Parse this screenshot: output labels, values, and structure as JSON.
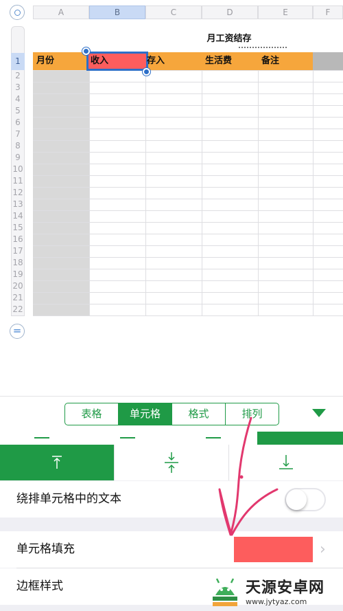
{
  "sheet": {
    "columns": [
      "A",
      "B",
      "C",
      "D",
      "E",
      "F"
    ],
    "selected_column": "B",
    "row_numbers": [
      "1",
      "2",
      "3",
      "4",
      "5",
      "6",
      "7",
      "8",
      "9",
      "10",
      "11",
      "12",
      "13",
      "14",
      "15",
      "16",
      "17",
      "18",
      "19",
      "20",
      "21",
      "22"
    ],
    "title": "月工资结存",
    "headers": [
      "月份",
      "收入",
      "存入",
      "生活费",
      "备注"
    ]
  },
  "tabs": [
    {
      "label": "表格",
      "active": false
    },
    {
      "label": "单元格",
      "active": true
    },
    {
      "label": "格式",
      "active": false
    },
    {
      "label": "排列",
      "active": false
    }
  ],
  "settings": {
    "wrap_text_label": "绕排单元格中的文本",
    "wrap_text_on": false,
    "cell_fill_label": "单元格填充",
    "cell_fill_color": "#fd5d5d",
    "border_style_label": "边框样式"
  },
  "colors": {
    "accent": "#1f9a46",
    "header_fill": "#f6a63c",
    "selection": "#2d6fc8"
  },
  "watermark": {
    "title": "天源安卓网",
    "url": "www.jytyaz.com"
  }
}
